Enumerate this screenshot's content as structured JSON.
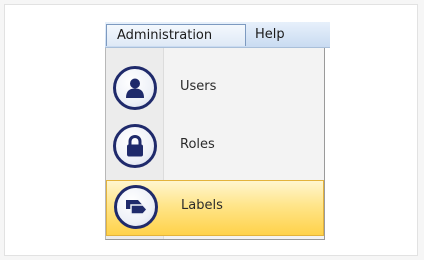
{
  "menubar": {
    "menus": [
      {
        "label": "Administration"
      },
      {
        "label": "Help"
      }
    ]
  },
  "dropdown": {
    "items": [
      {
        "label": "Users",
        "icon": "user-icon"
      },
      {
        "label": "Roles",
        "icon": "lock-icon"
      },
      {
        "label": "Labels",
        "icon": "labels-icon",
        "highlighted": true
      }
    ]
  },
  "colors": {
    "icon_navy": "#1f2a6b",
    "highlight_gold": "#ffd24a",
    "menubar_blue": "#c9dbf1"
  }
}
